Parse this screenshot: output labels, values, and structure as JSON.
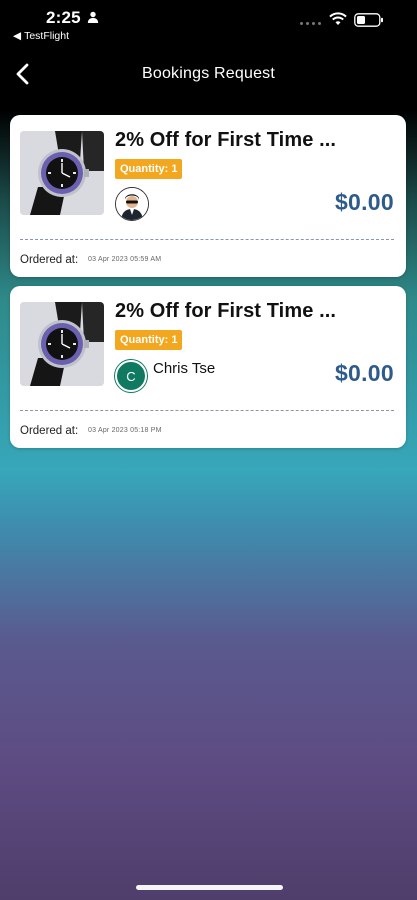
{
  "status_bar": {
    "time": "2:25",
    "back_app": "TestFlight"
  },
  "nav": {
    "title": "Bookings Request"
  },
  "bookings": [
    {
      "title": "2% Off for First Time ...",
      "quantity": "Quantity: 1",
      "user_name": "",
      "avatar": "photo",
      "price": "$0.00",
      "ordered_label": "Ordered at:",
      "ordered_at": "03 Apr 2023 05:59 AM"
    },
    {
      "title": "2% Off for First Time ...",
      "quantity": "Quantity: 1",
      "user_name": "Chris Tse",
      "avatar_letter": "C",
      "price": "$0.00",
      "ordered_label": "Ordered at:",
      "ordered_at": "03 Apr 2023 05:18 PM"
    }
  ],
  "colors": {
    "price": "#2f5b8c",
    "quantity_badge": "#f3a71f",
    "avatar_letter_bg": "#0f7a60"
  }
}
